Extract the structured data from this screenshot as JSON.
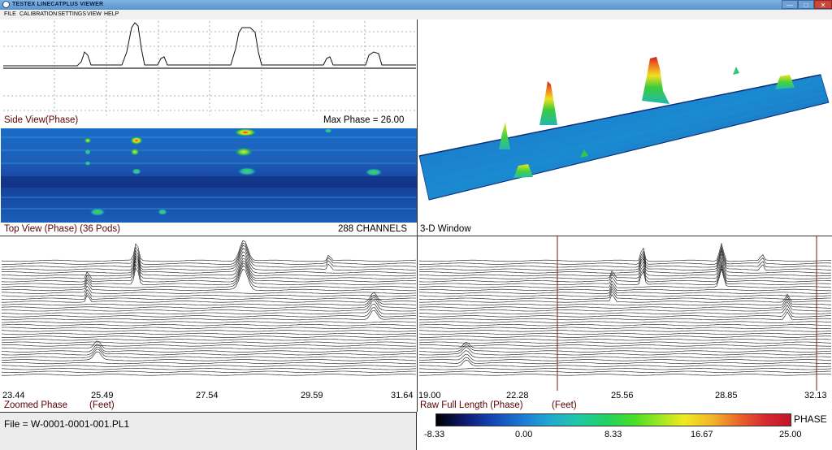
{
  "window": {
    "title": "TESTEX LINECATPLUS VIEWER",
    "minimize": "—",
    "maximize": "□",
    "close": "✕"
  },
  "menu": [
    "FILE",
    "CALIBRATION",
    "SETTINGS",
    "VIEW",
    "HELP"
  ],
  "side_view": {
    "label": "Side View(Phase)",
    "max_phase": "Max Phase = 26.00"
  },
  "top_view": {
    "label": "Top View (Phase) (36 Pods)",
    "channels": "288 CHANNELS"
  },
  "window_3d": {
    "label": "3-D Window"
  },
  "zoomed": {
    "label": "Zoomed Phase",
    "unit": "(Feet)",
    "ticks": [
      "23.44",
      "25.49",
      "27.54",
      "29.59",
      "31.64"
    ]
  },
  "raw": {
    "label": "Raw Full Length (Phase)",
    "unit": "(Feet)",
    "ticks": [
      "19.00",
      "22.28",
      "25.56",
      "28.85",
      "32.13"
    ]
  },
  "status": {
    "file": "File = W-0001-0001-001.PL1"
  },
  "colorbar": {
    "label": "PHASE",
    "ticks": [
      "-8.33",
      "0.00",
      "8.33",
      "16.67",
      "25.00"
    ]
  },
  "colors": {
    "label_red": "#5a0000",
    "heat_low": "#0d1a6e",
    "heat_high": "#c2152a",
    "frame": "#1c1c1c"
  }
}
